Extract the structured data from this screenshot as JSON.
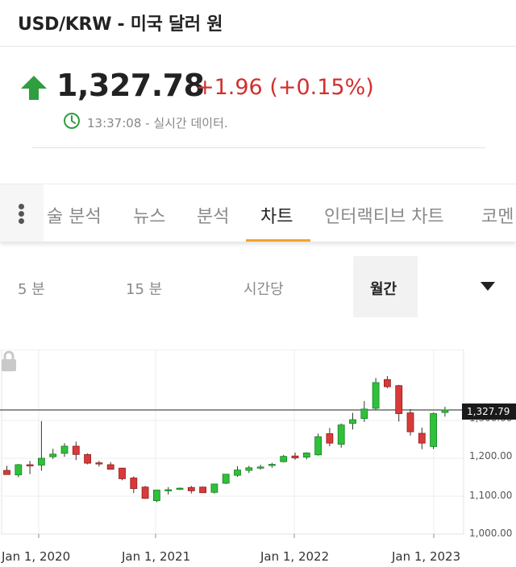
{
  "header": {
    "title": "USD/KRW - 미국 달러 원"
  },
  "quote": {
    "price": "1,327.78",
    "change": "+1.96 (+0.15%)",
    "time_text": "13:37:08 - 실시간 데이터.",
    "direction_icon": "arrow-up-icon",
    "up_color": "#2e9e3f",
    "down_color": "#d32f2f"
  },
  "tabs": {
    "items": [
      "술 분석",
      "뉴스",
      "분석",
      "차트",
      "인터랙티브 차트",
      "코멘"
    ],
    "active": "차트",
    "accent": "#f2a52a"
  },
  "periods": {
    "items": [
      "5 분",
      "15 분",
      "시간당",
      "월간"
    ],
    "active": "월간"
  },
  "chart_data": {
    "type": "candlestick",
    "last_price_label": "1,327.79",
    "y_tick_labels": [
      "1,300.00",
      "1,200.00",
      "1,100.00",
      "1,000.00"
    ],
    "x_tick_labels": [
      "Jan 1, 2020",
      "Jan 1, 2021",
      "Jan 1, 2022",
      "Jan 1, 2023"
    ],
    "ylim": [
      1000,
      1410
    ],
    "grid": true,
    "candles": [
      {
        "o": 1168,
        "h": 1180,
        "l": 1157,
        "c": 1157
      },
      {
        "o": 1156,
        "h": 1185,
        "l": 1150,
        "c": 1183
      },
      {
        "o": 1183,
        "h": 1193,
        "l": 1158,
        "c": 1182
      },
      {
        "o": 1182,
        "h": 1298,
        "l": 1167,
        "c": 1200
      },
      {
        "o": 1204,
        "h": 1225,
        "l": 1198,
        "c": 1211
      },
      {
        "o": 1213,
        "h": 1240,
        "l": 1204,
        "c": 1232
      },
      {
        "o": 1232,
        "h": 1244,
        "l": 1195,
        "c": 1210
      },
      {
        "o": 1210,
        "h": 1213,
        "l": 1184,
        "c": 1187
      },
      {
        "o": 1188,
        "h": 1193,
        "l": 1178,
        "c": 1186
      },
      {
        "o": 1183,
        "h": 1190,
        "l": 1170,
        "c": 1171
      },
      {
        "o": 1174,
        "h": 1175,
        "l": 1142,
        "c": 1146
      },
      {
        "o": 1148,
        "h": 1152,
        "l": 1108,
        "c": 1120
      },
      {
        "o": 1124,
        "h": 1127,
        "l": 1093,
        "c": 1094
      },
      {
        "o": 1088,
        "h": 1114,
        "l": 1084,
        "c": 1116
      },
      {
        "o": 1116,
        "h": 1124,
        "l": 1104,
        "c": 1117
      },
      {
        "o": 1118,
        "h": 1123,
        "l": 1116,
        "c": 1121
      },
      {
        "o": 1123,
        "h": 1127,
        "l": 1107,
        "c": 1114
      },
      {
        "o": 1124,
        "h": 1125,
        "l": 1109,
        "c": 1109
      },
      {
        "o": 1110,
        "h": 1133,
        "l": 1107,
        "c": 1132
      },
      {
        "o": 1134,
        "h": 1158,
        "l": 1132,
        "c": 1158
      },
      {
        "o": 1155,
        "h": 1179,
        "l": 1151,
        "c": 1169
      },
      {
        "o": 1168,
        "h": 1180,
        "l": 1161,
        "c": 1175
      },
      {
        "o": 1176,
        "h": 1183,
        "l": 1170,
        "c": 1177
      },
      {
        "o": 1181,
        "h": 1188,
        "l": 1175,
        "c": 1184
      },
      {
        "o": 1191,
        "h": 1209,
        "l": 1189,
        "c": 1205
      },
      {
        "o": 1206,
        "h": 1215,
        "l": 1196,
        "c": 1201
      },
      {
        "o": 1203,
        "h": 1216,
        "l": 1197,
        "c": 1214
      },
      {
        "o": 1209,
        "h": 1265,
        "l": 1207,
        "c": 1257
      },
      {
        "o": 1265,
        "h": 1280,
        "l": 1232,
        "c": 1240
      },
      {
        "o": 1237,
        "h": 1292,
        "l": 1228,
        "c": 1288
      },
      {
        "o": 1292,
        "h": 1320,
        "l": 1276,
        "c": 1302
      },
      {
        "o": 1305,
        "h": 1351,
        "l": 1296,
        "c": 1330
      },
      {
        "o": 1332,
        "h": 1412,
        "l": 1328,
        "c": 1400
      },
      {
        "o": 1408,
        "h": 1417,
        "l": 1385,
        "c": 1389
      },
      {
        "o": 1392,
        "h": 1394,
        "l": 1297,
        "c": 1318
      },
      {
        "o": 1320,
        "h": 1330,
        "l": 1260,
        "c": 1270
      },
      {
        "o": 1266,
        "h": 1281,
        "l": 1224,
        "c": 1240
      },
      {
        "o": 1231,
        "h": 1321,
        "l": 1224,
        "c": 1318
      },
      {
        "o": 1321,
        "h": 1336,
        "l": 1310,
        "c": 1327.79
      }
    ]
  }
}
